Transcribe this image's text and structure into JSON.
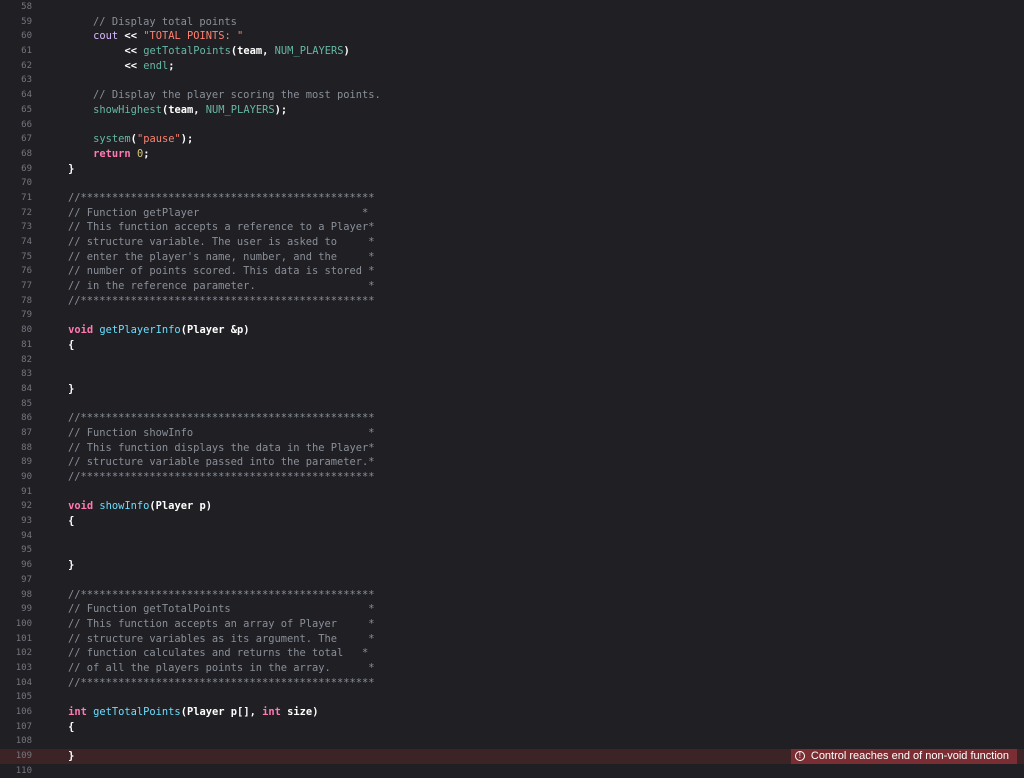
{
  "editor": {
    "lines": [
      {
        "n": "58",
        "t": ""
      },
      {
        "n": "59",
        "t": "        // Display total points"
      },
      {
        "n": "60",
        "t": "        cout << \"TOTAL POINTS: \""
      },
      {
        "n": "61",
        "t": "             << getTotalPoints(team, NUM_PLAYERS)"
      },
      {
        "n": "62",
        "t": "             << endl;"
      },
      {
        "n": "63",
        "t": ""
      },
      {
        "n": "64",
        "t": "        // Display the player scoring the most points."
      },
      {
        "n": "65",
        "t": "        showHighest(team, NUM_PLAYERS);"
      },
      {
        "n": "66",
        "t": ""
      },
      {
        "n": "67",
        "t": "        system(\"pause\");"
      },
      {
        "n": "68",
        "t": "        return 0;"
      },
      {
        "n": "69",
        "t": "    }"
      },
      {
        "n": "70",
        "t": ""
      },
      {
        "n": "71",
        "t": "    //***********************************************"
      },
      {
        "n": "72",
        "t": "    // Function getPlayer                          *"
      },
      {
        "n": "73",
        "t": "    // This function accepts a reference to a Player*"
      },
      {
        "n": "74",
        "t": "    // structure variable. The user is asked to     *"
      },
      {
        "n": "75",
        "t": "    // enter the player's name, number, and the     *"
      },
      {
        "n": "76",
        "t": "    // number of points scored. This data is stored *"
      },
      {
        "n": "77",
        "t": "    // in the reference parameter.                  *"
      },
      {
        "n": "78",
        "t": "    //***********************************************"
      },
      {
        "n": "79",
        "t": ""
      },
      {
        "n": "80",
        "t": "    void getPlayerInfo(Player &p)"
      },
      {
        "n": "81",
        "t": "    {"
      },
      {
        "n": "82",
        "t": ""
      },
      {
        "n": "83",
        "t": ""
      },
      {
        "n": "84",
        "t": "    }"
      },
      {
        "n": "85",
        "t": ""
      },
      {
        "n": "86",
        "t": "    //***********************************************"
      },
      {
        "n": "87",
        "t": "    // Function showInfo                            *"
      },
      {
        "n": "88",
        "t": "    // This function displays the data in the Player*"
      },
      {
        "n": "89",
        "t": "    // structure variable passed into the parameter.*"
      },
      {
        "n": "90",
        "t": "    //***********************************************"
      },
      {
        "n": "91",
        "t": ""
      },
      {
        "n": "92",
        "t": "    void showInfo(Player p)"
      },
      {
        "n": "93",
        "t": "    {"
      },
      {
        "n": "94",
        "t": ""
      },
      {
        "n": "95",
        "t": ""
      },
      {
        "n": "96",
        "t": "    }"
      },
      {
        "n": "97",
        "t": ""
      },
      {
        "n": "98",
        "t": "    //***********************************************"
      },
      {
        "n": "99",
        "t": "    // Function getTotalPoints                      *"
      },
      {
        "n": "100",
        "t": "    // This function accepts an array of Player     *"
      },
      {
        "n": "101",
        "t": "    // structure variables as its argument. The     *"
      },
      {
        "n": "102",
        "t": "    // function calculates and returns the total   *"
      },
      {
        "n": "103",
        "t": "    // of all the players points in the array.      *"
      },
      {
        "n": "104",
        "t": "    //***********************************************"
      },
      {
        "n": "105",
        "t": ""
      },
      {
        "n": "106",
        "t": "    int getTotalPoints(Player p[], int size)"
      },
      {
        "n": "107",
        "t": "    {"
      },
      {
        "n": "108",
        "t": ""
      },
      {
        "n": "109",
        "t": "    }"
      },
      {
        "n": "110",
        "t": ""
      }
    ],
    "error": {
      "line": "109",
      "icon": "error-circle-icon",
      "message": "Control reaches end of non-void function"
    }
  }
}
